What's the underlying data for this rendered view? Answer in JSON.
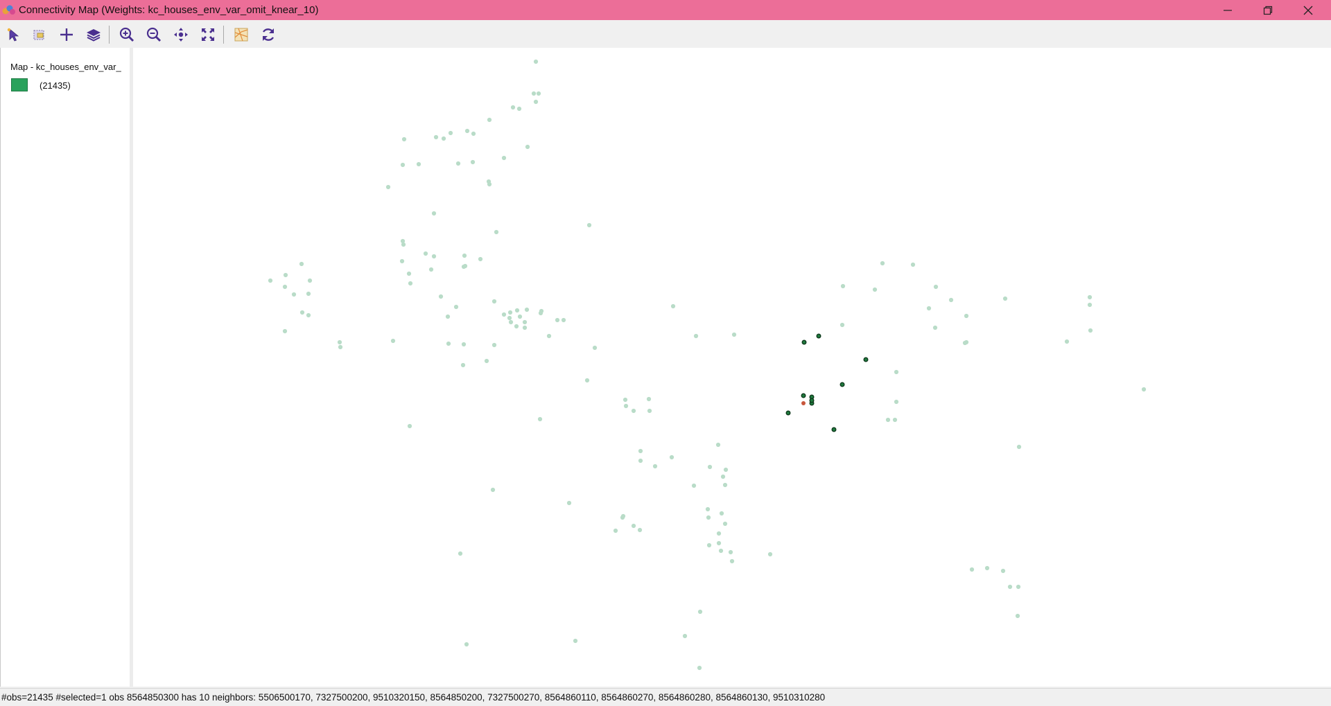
{
  "window": {
    "title": "Connectivity Map (Weights: kc_houses_env_var_omit_knear_10)",
    "controls": [
      "minimize",
      "restore",
      "close"
    ]
  },
  "toolbar": {
    "buttons": [
      {
        "name": "select-tool-button",
        "icon": "pointer-arrow-icon"
      },
      {
        "name": "select-by-shape-button",
        "icon": "select-shape-icon"
      },
      {
        "name": "add-button",
        "icon": "plus-icon"
      },
      {
        "name": "layers-button",
        "icon": "layers-icon"
      },
      {
        "name": "zoom-in-button",
        "icon": "zoom-in-icon"
      },
      {
        "name": "zoom-out-button",
        "icon": "zoom-out-icon"
      },
      {
        "name": "pan-button",
        "icon": "pan-arrows-icon"
      },
      {
        "name": "full-extent-button",
        "icon": "full-extent-icon"
      },
      {
        "name": "basemap-button",
        "icon": "basemap-icon"
      },
      {
        "name": "refresh-button",
        "icon": "refresh-icon"
      }
    ]
  },
  "legend": {
    "title": "Map - kc_houses_env_var_",
    "items": [
      {
        "label": "(21435)",
        "color": "#2aa25c"
      }
    ]
  },
  "map": {
    "point_color": "#b9dcc8",
    "neighbor_fill": "#1f7a3e",
    "neighbor_stroke": "#0f3a1c",
    "selected_fill": "#c8573c"
  },
  "status": {
    "text": "#obs=21435 #selected=1  obs 8564850300 has 10 neighbors: 5506500170, 7327500200, 9510320150, 8564850200, 7327500270, 8564860110, 8564860270, 8564860280, 8564860130, 9510310280"
  }
}
